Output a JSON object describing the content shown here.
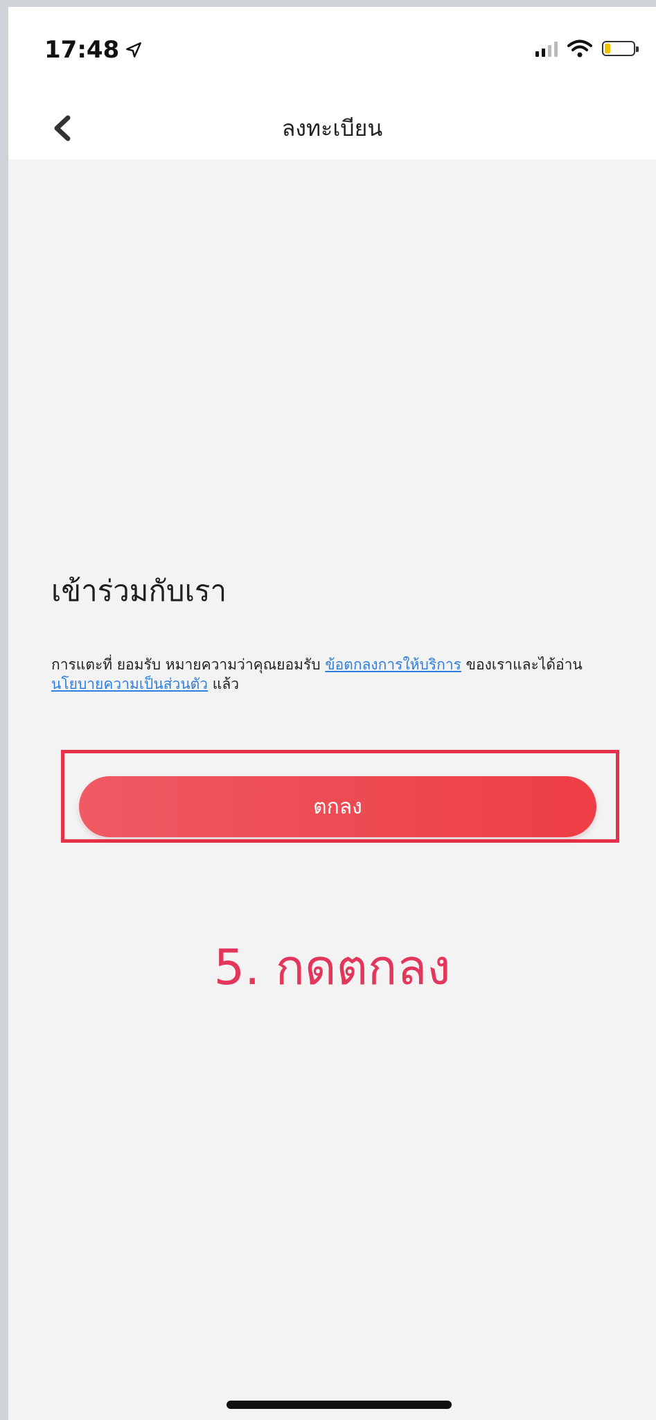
{
  "status_bar": {
    "time": "17:48"
  },
  "nav": {
    "title": "ลงทะเบียน"
  },
  "main": {
    "heading": "เข้าร่วมกับเรา",
    "terms": {
      "part1": "การแตะที่ ยอมรับ หมายความว่าคุณยอมรับ ",
      "link_terms": "ข้อตกลงการให้บริการ",
      "part2": " ของเราและได้อ่าน ",
      "link_privacy": "นโยบายความเป็นส่วนตัว",
      "part3": " แล้ว"
    },
    "accept_label": "ตกลง",
    "step_caption": "5. กดตกลง"
  },
  "colors": {
    "accent": "#ee3d45",
    "highlight": "#e6314a",
    "link": "#2d7fe0"
  }
}
